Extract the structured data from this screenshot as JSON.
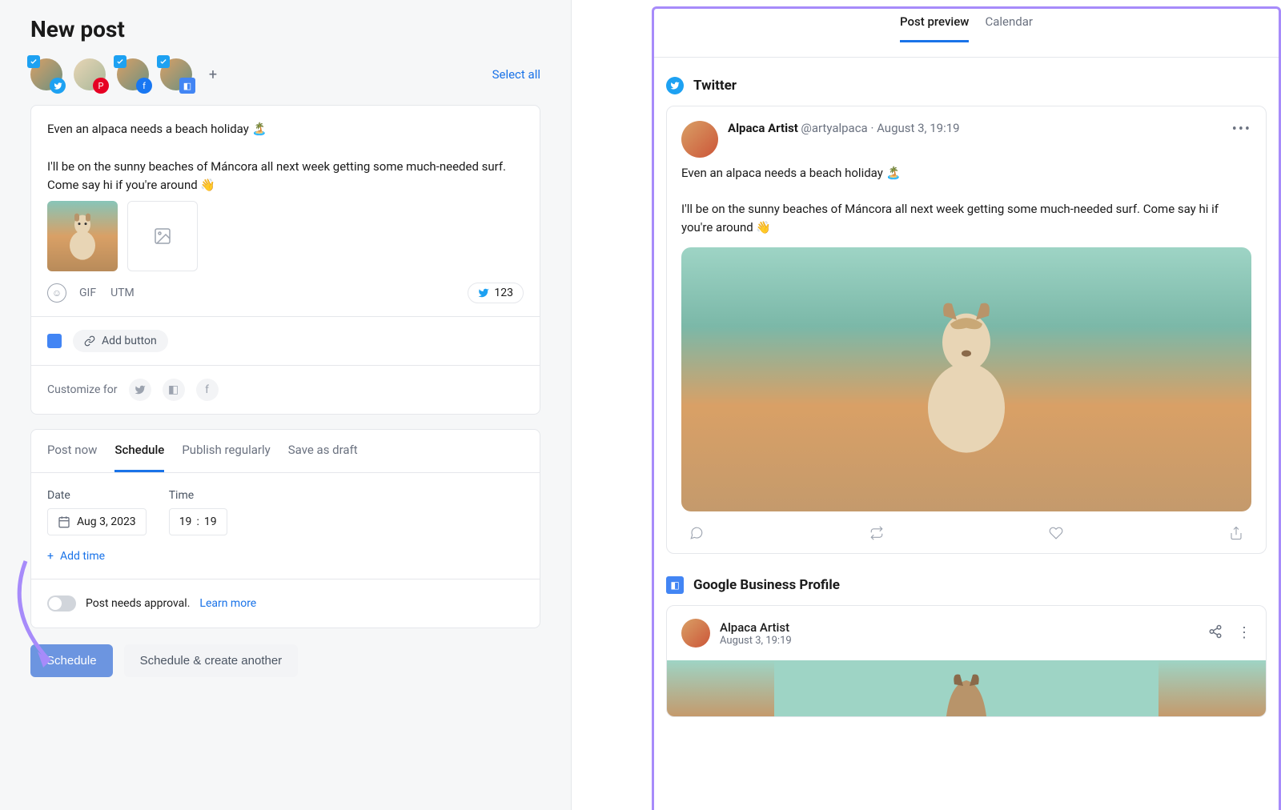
{
  "page_title": "New post",
  "select_all": "Select all",
  "accounts": [
    {
      "checked": true,
      "platform": "twitter"
    },
    {
      "checked": false,
      "platform": "pinterest"
    },
    {
      "checked": true,
      "platform": "facebook"
    },
    {
      "checked": true,
      "platform": "gbp"
    }
  ],
  "composer": {
    "text": "Even an alpaca needs a beach holiday 🏝️\n\nI'll be on the sunny beaches of Máncora all next week getting some much-needed surf. Come say hi if you're around 👋",
    "tools": {
      "gif": "GIF",
      "utm": "UTM"
    },
    "char_count": "123",
    "add_button_label": "Add button",
    "customize_label": "Customize for"
  },
  "publish_tabs": {
    "post_now": "Post now",
    "schedule": "Schedule",
    "publish_regularly": "Publish regularly",
    "save_as_draft": "Save as draft"
  },
  "schedule": {
    "date_label": "Date",
    "time_label": "Time",
    "date_value": "Aug 3, 2023",
    "time_hour": "19",
    "time_minute": "19",
    "add_time": "Add time"
  },
  "approval": {
    "text": "Post needs approval.",
    "learn_more": "Learn more"
  },
  "actions": {
    "schedule": "Schedule",
    "schedule_another": "Schedule & create another"
  },
  "right": {
    "tabs": {
      "preview": "Post preview",
      "calendar": "Calendar"
    },
    "twitter": {
      "title": "Twitter",
      "author": "Alpaca Artist",
      "handle": "@artyalpaca",
      "timestamp": "August 3, 19:19",
      "text": "Even an alpaca needs a beach holiday 🏝️\n\nI'll be on the sunny beaches of Máncora all next week getting some much-needed surf. Come say hi if you're around 👋"
    },
    "gbp": {
      "title": "Google Business Profile",
      "author": "Alpaca Artist",
      "timestamp": "August 3, 19:19"
    }
  }
}
